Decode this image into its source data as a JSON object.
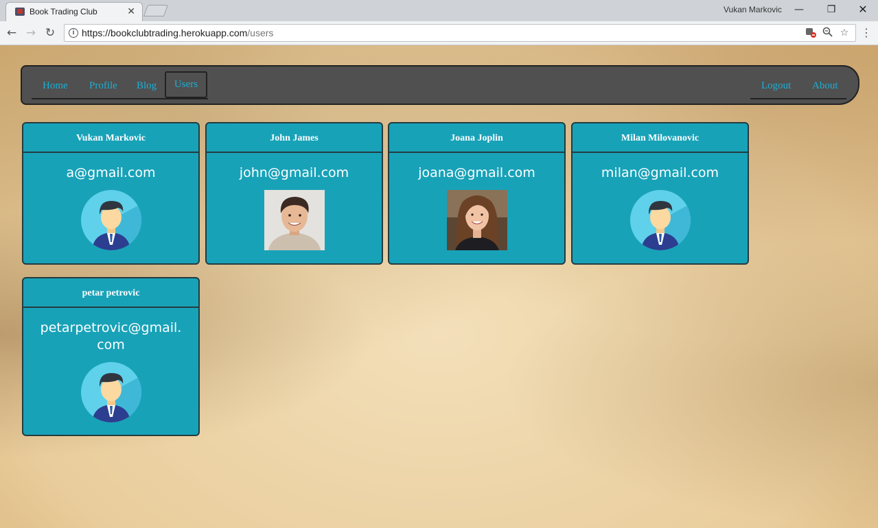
{
  "browser": {
    "tab_title": "Book Trading Club",
    "tab_close": "✕",
    "user_name": "Vukan Markovic",
    "url_host": "https://bookclubtrading.herokuapp.com",
    "url_path": "/users",
    "icons": [
      "back-arrow-icon",
      "forward-arrow-icon",
      "reload-icon",
      "info-icon",
      "extension-icon",
      "zoom-icon",
      "star-icon",
      "menu-icon"
    ]
  },
  "navbar": {
    "left": [
      {
        "label": "Home"
      },
      {
        "label": "Profile"
      },
      {
        "label": "Blog"
      },
      {
        "label": "Users",
        "active": true
      }
    ],
    "right": [
      {
        "label": "Logout"
      },
      {
        "label": "About"
      }
    ]
  },
  "users": [
    {
      "name": "Vukan Markovic",
      "email": "a@gmail.com",
      "picture": "default-avatar"
    },
    {
      "name": "John James",
      "email": "john@gmail.com",
      "picture": "photo-man"
    },
    {
      "name": "Joana Joplin",
      "email": "joana@gmail.com",
      "picture": "photo-woman"
    },
    {
      "name": "Milan Milovanovic",
      "email": "milan@gmail.com",
      "picture": "default-avatar"
    },
    {
      "name": "petar petrovic",
      "email": "petarpetrovic@gmail.com",
      "picture": "default-avatar"
    }
  ],
  "colors": {
    "card": "#18a2b8",
    "navbar": "#505050",
    "link": "#1bb0d6"
  }
}
